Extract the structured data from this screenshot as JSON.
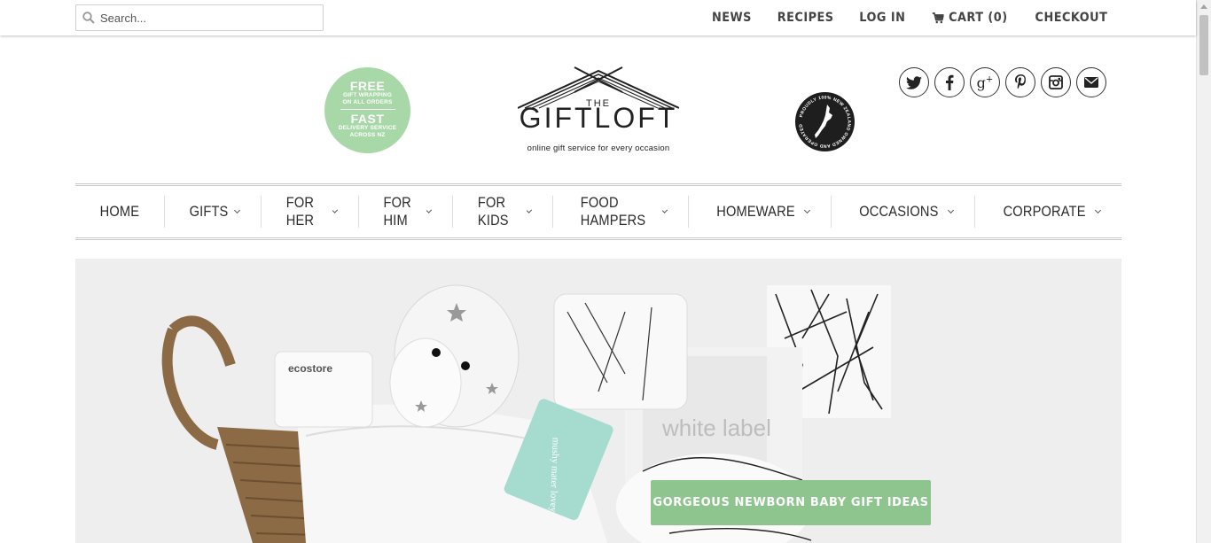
{
  "search": {
    "placeholder": "Search..."
  },
  "top_nav": {
    "news": "NEWS",
    "recipes": "RECIPES",
    "login": "LOG IN",
    "cart": "CART (0)",
    "checkout": "CHECKOUT"
  },
  "promo_badge": {
    "free": "FREE",
    "gift_line1": "GIFT WRAPPING",
    "gift_line2": "ON ALL ORDERS",
    "fast": "FAST",
    "delivery_line1": "DELIVERY SERVICE",
    "delivery_line2": "ACROSS NZ"
  },
  "logo": {
    "the": "THE",
    "name": "GIFTLOFT",
    "tagline": "online gift service for every occasion"
  },
  "nz_badge": {
    "text": "PROUDLY 100% NEW ZEALAND OWNED AND OPERATED"
  },
  "social_icons": [
    "twitter-icon",
    "facebook-icon",
    "google-plus-icon",
    "pinterest-icon",
    "instagram-icon",
    "email-icon"
  ],
  "main_nav": [
    {
      "label": "HOME",
      "dropdown": false
    },
    {
      "label": "GIFTS",
      "dropdown": true
    },
    {
      "label": "FOR HER",
      "dropdown": true
    },
    {
      "label": "FOR HIM",
      "dropdown": true
    },
    {
      "label": "FOR KIDS",
      "dropdown": true
    },
    {
      "label": "FOOD HAMPERS",
      "dropdown": true
    },
    {
      "label": "HOMEWARE",
      "dropdown": true
    },
    {
      "label": "OCCASIONS",
      "dropdown": true
    },
    {
      "label": "CORPORATE",
      "dropdown": true
    }
  ],
  "hero": {
    "cta": "GORGEOUS NEWBORN BABY GIFT IDEAS",
    "product_tag": "mushy mater lovey",
    "brand": "ecostore",
    "box_label": "white label"
  },
  "colors": {
    "accent_green": "#8ec48d",
    "badge_green": "#a9d8a8",
    "text_dark": "#222222"
  }
}
